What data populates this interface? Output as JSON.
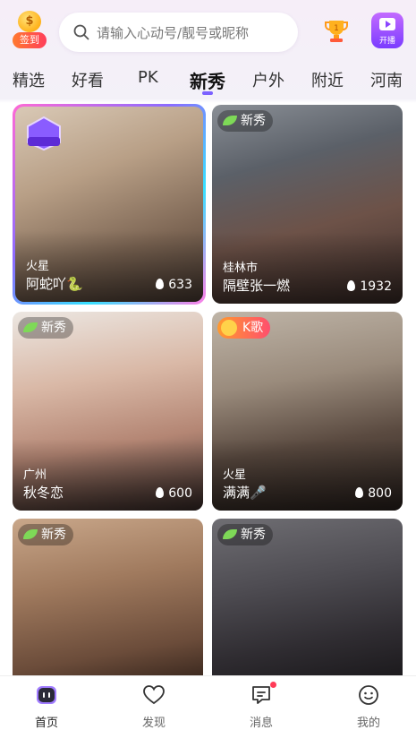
{
  "header": {
    "checkin_label": "签到",
    "checkin_coin_glyph": "$",
    "search_placeholder": "请输入心动号/靓号或昵称",
    "live_button_label": "开播",
    "icons": [
      "coin-icon",
      "search-icon",
      "trophy-icon",
      "live-camera-icon"
    ]
  },
  "tabs": [
    {
      "label": "精选"
    },
    {
      "label": "好看"
    },
    {
      "label": "PK"
    },
    {
      "label": "新秀",
      "active": true
    },
    {
      "label": "户外"
    },
    {
      "label": "附近"
    },
    {
      "label": "河南"
    }
  ],
  "cards": [
    {
      "location": "火星",
      "name": "阿蛇吖🐍",
      "heat": "633",
      "badge": "",
      "rank_badge": "百星闪耀",
      "featured": true
    },
    {
      "location": "桂林市",
      "name": "隔壁张一燃",
      "heat": "1932",
      "badge": "新秀"
    },
    {
      "location": "广州",
      "name": "秋冬恋",
      "heat": "600",
      "badge": "新秀"
    },
    {
      "location": "火星",
      "name": "满满🎤",
      "heat": "800",
      "badge": "K歌"
    },
    {
      "location": "",
      "name": "",
      "heat": "",
      "badge": "新秀"
    },
    {
      "location": "",
      "name": "",
      "heat": "",
      "badge": "新秀"
    }
  ],
  "bottom_nav": [
    {
      "label": "首页",
      "icon": "home-live-icon",
      "active": true
    },
    {
      "label": "发现",
      "icon": "heart-icon"
    },
    {
      "label": "消息",
      "icon": "message-icon",
      "has_dot": true
    },
    {
      "label": "我的",
      "icon": "smile-face-icon"
    }
  ],
  "colors": {
    "accent": "#7b61ff",
    "notification_dot": "#ff3b57",
    "checkin_gradient_start": "#ff7a2f",
    "checkin_gradient_end": "#ff3e5b",
    "badge_leaf": "#7ed957"
  }
}
